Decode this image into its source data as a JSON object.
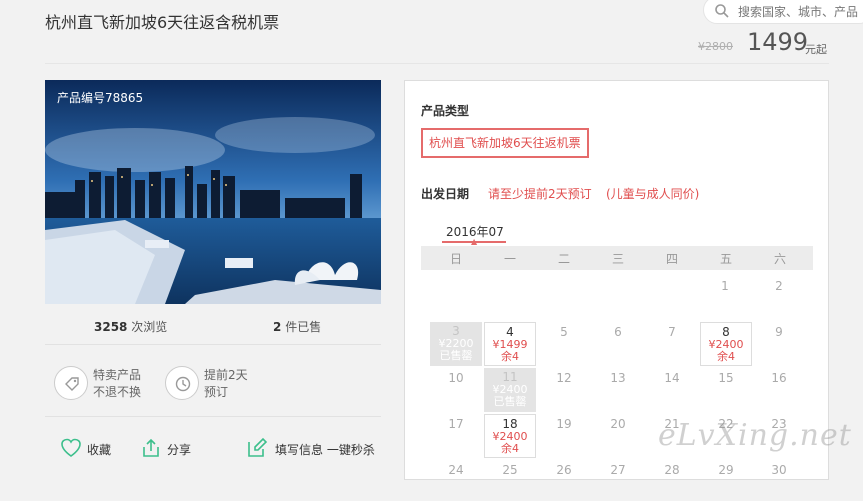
{
  "header": {
    "title": "杭州直飞新加坡6天往返含税机票",
    "search_placeholder": "搜索国家、城市、产品",
    "old_price": "¥2800",
    "price": "1499",
    "price_suffix": "元起"
  },
  "product": {
    "code": "产品编号78865",
    "views_count": "3258",
    "views_label": "次浏览",
    "sold_count": "2",
    "sold_label": "件已售"
  },
  "features": [
    {
      "icon": "tag-icon",
      "line1": "特卖产品",
      "line2": "不退不换"
    },
    {
      "icon": "clock-icon",
      "line1": "提前2天",
      "line2": "预订"
    }
  ],
  "actions": {
    "favorite": "收藏",
    "share": "分享",
    "quick_buy": "填写信息 一键秒杀"
  },
  "booking": {
    "type_label": "产品类型",
    "type_option": "杭州直飞新加坡6天往返机票",
    "date_label": "出发日期",
    "date_hint": "请至少提前2天预订",
    "date_hint2": "(儿童与成人同价)",
    "month": "2016年07",
    "weekdays": [
      "日",
      "一",
      "二",
      "三",
      "四",
      "五",
      "六"
    ]
  },
  "calendar": {
    "d1": "1",
    "d2": "2",
    "d3": "3",
    "d3_price": "¥2200",
    "d3_status": "已售罄",
    "d4": "4",
    "d4_price": "¥1499",
    "d4_status": "余4",
    "d5": "5",
    "d6": "6",
    "d7": "7",
    "d8": "8",
    "d8_price": "¥2400",
    "d8_status": "余4",
    "d9": "9",
    "d10": "10",
    "d11": "11",
    "d11_price": "¥2400",
    "d11_status": "已售罄",
    "d12": "12",
    "d13": "13",
    "d14": "14",
    "d15": "15",
    "d16": "16",
    "d17": "17",
    "d18": "18",
    "d18_price": "¥2400",
    "d18_status": "余4",
    "d19": "19",
    "d20": "20",
    "d21": "21",
    "d22": "22",
    "d23": "23",
    "d24": "24",
    "d25": "25",
    "d26": "26",
    "d27": "27",
    "d28": "28",
    "d29": "29",
    "d30": "30"
  },
  "watermark": "eLvXing.net",
  "colors": {
    "accent": "#e04e4e",
    "green": "#3cbf8c"
  }
}
